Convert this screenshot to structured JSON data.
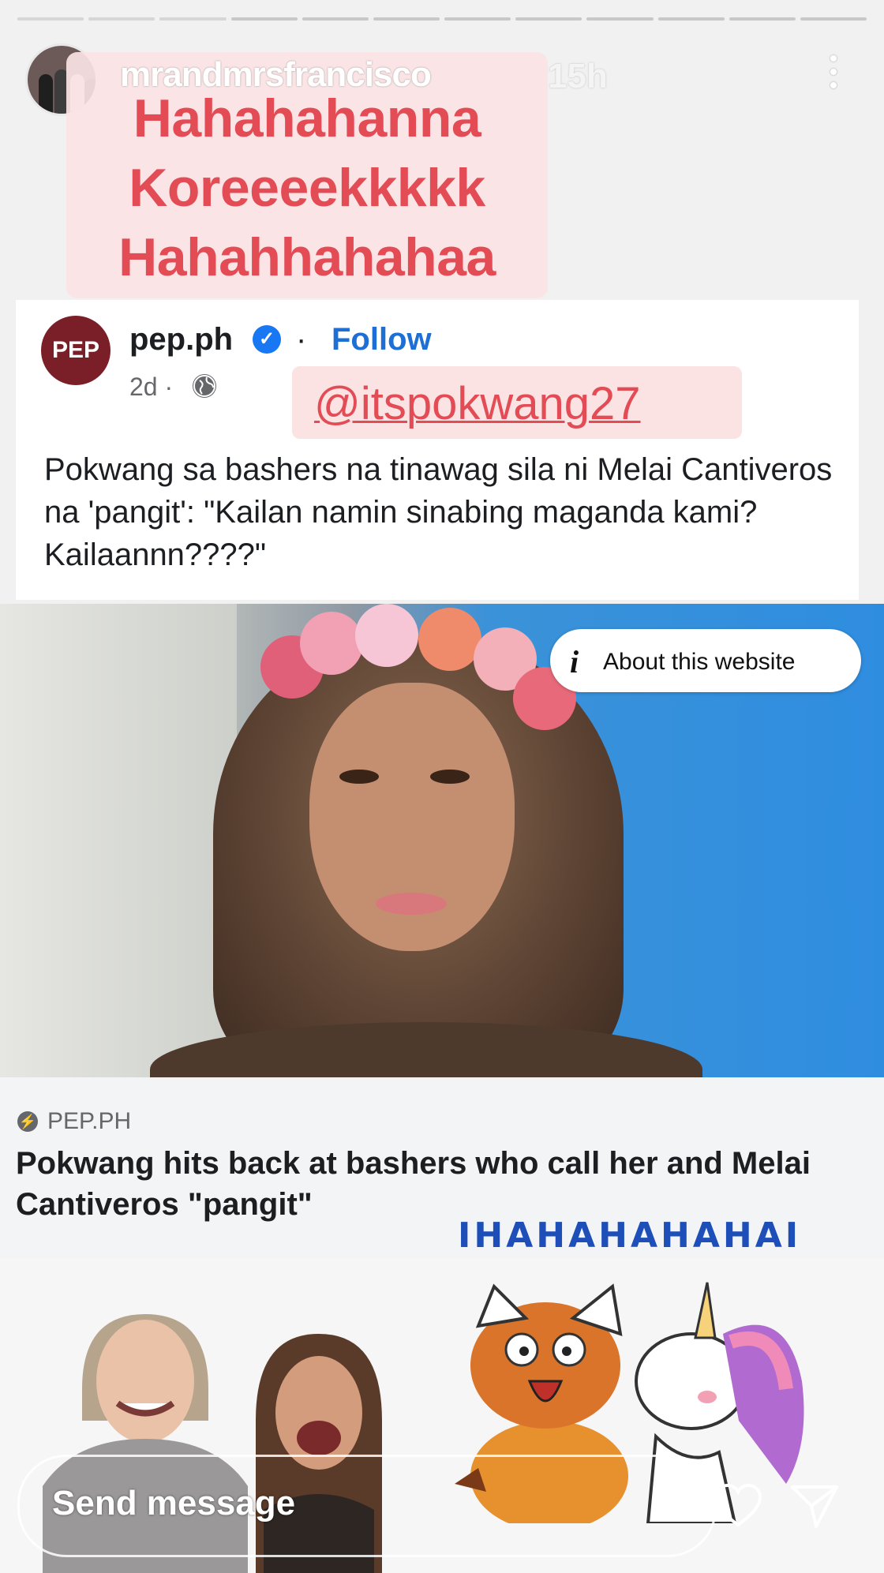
{
  "story": {
    "progress_segments": 12,
    "progress_completed": 3,
    "username": "mrandmrsfrancisco",
    "time_ago": "15h",
    "caption_lines": [
      "Hahahahanna",
      "Koreeeekkkkk",
      "Hahahhahahaa"
    ],
    "mention": "@itspokwang27",
    "laugh_text": "IHAHAHAHAHAI",
    "reply_placeholder": "Send message"
  },
  "post": {
    "publisher_logo_text": "PEP",
    "publisher": "pep.ph",
    "separator": "·",
    "follow_label": "Follow",
    "age": "2d ·",
    "text": "Pokwang sa bashers na tinawag sila ni Melai Cantiveros na 'pangit': \"Kailan namin sinabing maganda kami? Kailaannn????\"",
    "about_label": "About this website",
    "link_site": "PEP.PH",
    "link_title": "Pokwang hits back at bashers who call her and Melai Cantiveros \"pangit\""
  },
  "colors": {
    "caption_text": "#e34b55",
    "caption_bg": "#fbe3e4",
    "follow_blue": "#1d6fd6",
    "laugh_blue": "#1e4fb8",
    "pep_brand": "#7a1f28"
  },
  "icons": [
    "more-icon",
    "verified-icon",
    "globe-icon",
    "info-icon",
    "bolt-icon",
    "heart-icon",
    "share-icon"
  ]
}
